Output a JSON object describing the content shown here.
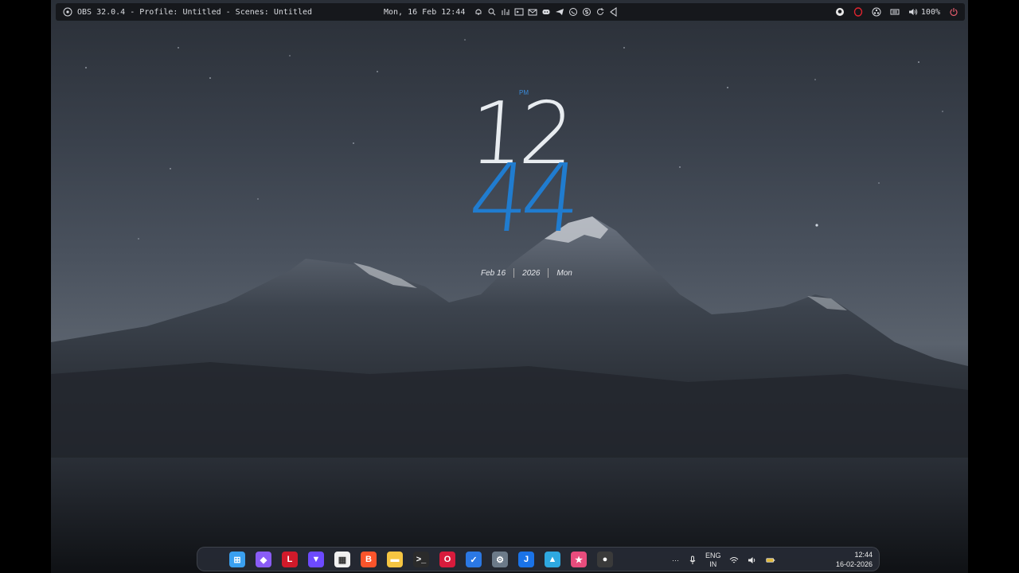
{
  "topbar": {
    "window_title": "OBS 32.0.4 - Profile: Untitled - Scenes: Untitled",
    "datetime": "Mon, 16 Feb 12:44",
    "icons": [
      "bell-icon",
      "search-icon",
      "chart-icon",
      "terminal-icon",
      "mail-icon",
      "discord-icon",
      "telegram-icon",
      "whatsapp-icon",
      "skype-icon",
      "refresh-icon",
      "vscode-icon"
    ],
    "right_icons": [
      "github-icon",
      "opera-icon",
      "obs-icon",
      "keyboard-icon",
      "volume-icon",
      "power-icon"
    ],
    "volume": "100%"
  },
  "clock": {
    "ampm": "PM",
    "hour": "12",
    "minute": "44",
    "date": "Feb 16",
    "year": "2026",
    "weekday": "Mon"
  },
  "taskbar": {
    "apps": [
      {
        "name": "start-icon",
        "color": "#3aa0f0",
        "glyph": "⊞"
      },
      {
        "name": "obsidian-icon",
        "color": "#8a5cf6",
        "glyph": "◆"
      },
      {
        "name": "lexi-icon",
        "color": "#d11a2a",
        "glyph": "L"
      },
      {
        "name": "proton-vpn-icon",
        "color": "#6d4aff",
        "glyph": "▼"
      },
      {
        "name": "store-icon",
        "color": "#f0f0f0",
        "glyph": "▦"
      },
      {
        "name": "brave-icon",
        "color": "#fb542b",
        "glyph": "B"
      },
      {
        "name": "file-explorer-icon",
        "color": "#f5c542",
        "glyph": "▬"
      },
      {
        "name": "terminal-icon",
        "color": "#2b2b2b",
        "glyph": ">_"
      },
      {
        "name": "opera-icon",
        "color": "#d81b3c",
        "glyph": "O"
      },
      {
        "name": "todo-icon",
        "color": "#2b78e4",
        "glyph": "✓"
      },
      {
        "name": "settings-icon",
        "color": "#6c7a89",
        "glyph": "⚙"
      },
      {
        "name": "j-app-icon",
        "color": "#1a73e8",
        "glyph": "J"
      },
      {
        "name": "photos-icon",
        "color": "#2ea8e0",
        "glyph": "▲"
      },
      {
        "name": "paint-icon",
        "color": "#e84c7d",
        "glyph": "★"
      },
      {
        "name": "obs-icon",
        "color": "#3a3a3a",
        "glyph": "●"
      }
    ],
    "tray": {
      "more": "···",
      "lang_top": "ENG",
      "lang_bottom": "IN",
      "time": "12:44",
      "date": "16-02-2026"
    }
  }
}
